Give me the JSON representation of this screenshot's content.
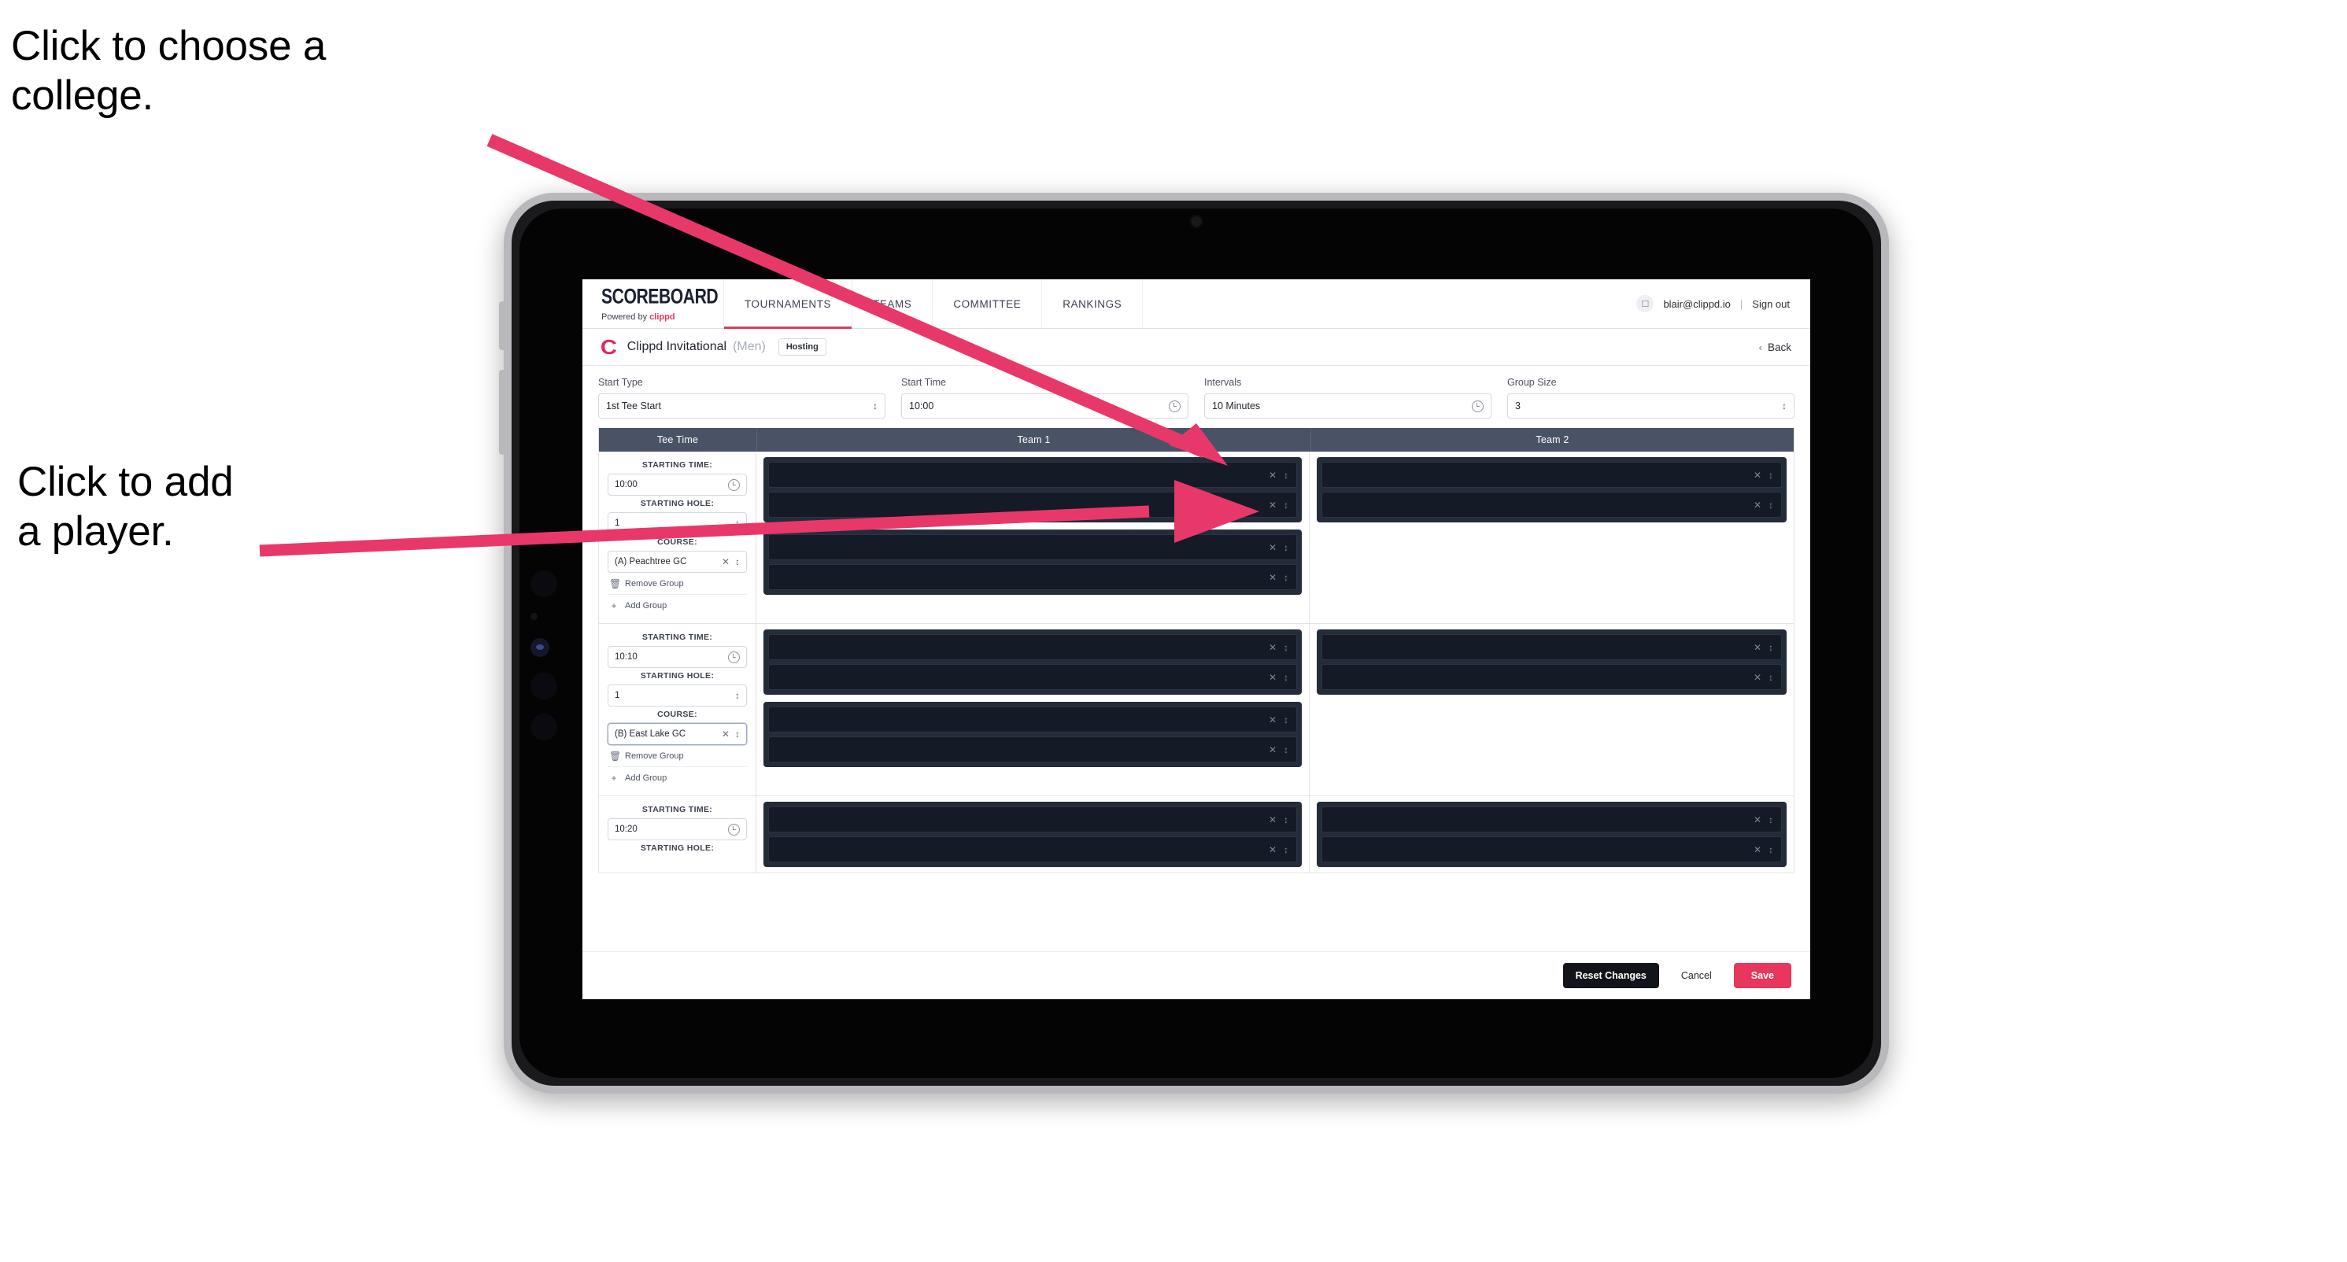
{
  "annotations": {
    "college": "Click to choose a\ncollege.",
    "player": "Click to add\na player."
  },
  "colors": {
    "accent_pink": "#e8365d",
    "arrow_pink": "#e8386a",
    "table_header": "#4a5266",
    "slot_dark": "#141a26",
    "slot_block": "#242c3a"
  },
  "topnav": {
    "brand_word": "SCOREBOARD",
    "brand_powered": "Powered by ",
    "brand_clippd": "clippd",
    "tabs": [
      {
        "label": "TOURNAMENTS",
        "active": true
      },
      {
        "label": "TEAMS",
        "active": false
      },
      {
        "label": "COMMITTEE",
        "active": false
      },
      {
        "label": "RANKINGS",
        "active": false
      }
    ],
    "avatar_glyph": "user-icon",
    "email": "blair@clippd.io",
    "separator": "|",
    "sign_out": "Sign out"
  },
  "titlebar": {
    "logo_mark": "C",
    "title": "Clippd Invitational",
    "gender": "(Men)",
    "chip": "Hosting",
    "back_chevron": "‹",
    "back_label": "Back"
  },
  "filters": [
    {
      "label": "Start Type",
      "value": "1st Tee Start",
      "control": "select",
      "icon": "stepper-icon"
    },
    {
      "label": "Start Time",
      "value": "10:00",
      "control": "time",
      "icon": "clock-icon"
    },
    {
      "label": "Intervals",
      "value": "10 Minutes",
      "control": "time",
      "icon": "clock-icon"
    },
    {
      "label": "Group Size",
      "value": "3",
      "control": "select",
      "icon": "stepper-icon"
    }
  ],
  "table": {
    "headers": [
      "Tee Time",
      "Team 1",
      "Team 2"
    ],
    "labels": {
      "starting_time": "STARTING TIME:",
      "starting_hole": "STARTING HOLE:",
      "course": "COURSE:",
      "remove_group": "Remove Group",
      "add_group": "Add Group"
    },
    "groups": [
      {
        "starting_time": "10:00",
        "starting_hole": "1",
        "course": "(A) Peachtree GC",
        "course_focused": false,
        "team1_blocks": [
          {
            "slots": [
              "",
              ""
            ]
          },
          {
            "slots": [
              "",
              ""
            ]
          }
        ],
        "team2_blocks": [
          {
            "slots": [
              "",
              ""
            ]
          }
        ]
      },
      {
        "starting_time": "10:10",
        "starting_hole": "1",
        "course": "(B) East Lake GC",
        "course_focused": true,
        "team1_blocks": [
          {
            "slots": [
              "",
              ""
            ]
          },
          {
            "slots": [
              "",
              ""
            ]
          }
        ],
        "team2_blocks": [
          {
            "slots": [
              "",
              ""
            ]
          }
        ]
      },
      {
        "starting_time": "10:20",
        "starting_hole": "",
        "course": "",
        "course_focused": false,
        "team1_blocks": [
          {
            "slots": [
              "",
              ""
            ]
          }
        ],
        "team2_blocks": [
          {
            "slots": [
              "",
              ""
            ]
          }
        ]
      }
    ]
  },
  "footer": {
    "reset": "Reset Changes",
    "cancel": "Cancel",
    "save": "Save"
  }
}
